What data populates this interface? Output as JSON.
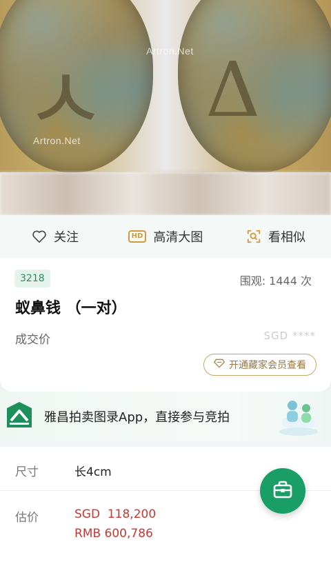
{
  "hero": {
    "watermark_1": "Artron.Net",
    "watermark_2": "Artron.Net"
  },
  "actions": {
    "follow_label": "关注",
    "hd_badge": "HD",
    "hd_label": "高清大图",
    "similar_label": "看相似"
  },
  "lot": {
    "number": "3218",
    "views": "围观: 1444 次",
    "title": "蚁鼻钱 （一对）",
    "sold_label": "成交价",
    "sold_value": "SGD ****",
    "vip_button": "开通藏家会员查看"
  },
  "banner": {
    "text": "雅昌拍卖图录App，直接参与竞拍"
  },
  "details": {
    "size_label": "尺寸",
    "size_value": "长4cm",
    "estimate_label": "估价",
    "estimate_sgd": "SGD  118,200",
    "estimate_rmb": "RMB 600,786"
  },
  "colors": {
    "accent_green": "#1a9e68",
    "price_red": "#c8372f",
    "gold": "#c7a56b"
  }
}
